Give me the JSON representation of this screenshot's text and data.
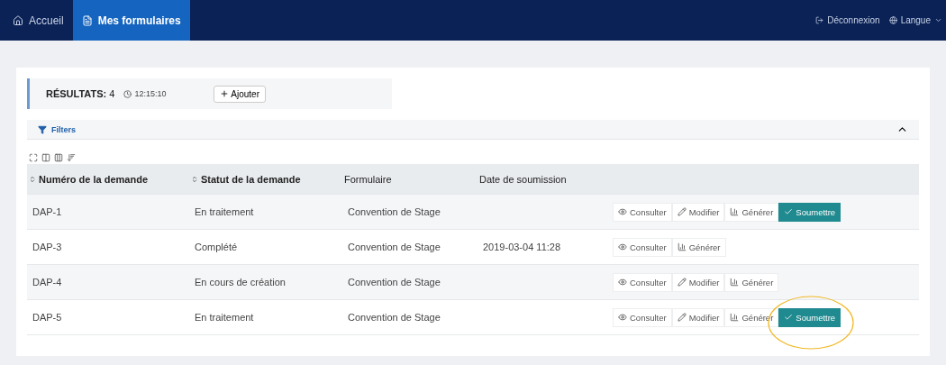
{
  "navbar": {
    "tabs": [
      {
        "kind": "home",
        "label": "Accueil",
        "selected": false
      },
      {
        "kind": "forms",
        "label": "Mes formulaires",
        "selected": true
      }
    ],
    "links": [
      {
        "kind": "logout",
        "label": "Déconnexion"
      },
      {
        "kind": "language",
        "label": "Langue"
      }
    ]
  },
  "results": {
    "label": "RÉSULTATS:",
    "count": "4",
    "time": "12:15:10",
    "add_button": "Ajouter"
  },
  "filters": {
    "label": "Filters",
    "expanded": true
  },
  "table": {
    "columns": [
      {
        "label": "Numéro de la demande",
        "sortable": true
      },
      {
        "label": "Statut de la demande",
        "sortable": true
      },
      {
        "label": "Formulaire",
        "sortable": false
      },
      {
        "label": "Date de soumission",
        "sortable": false
      }
    ],
    "rows": [
      {
        "cells": [
          "DAP-1",
          "En traitement",
          "Convention de Stage",
          ""
        ],
        "circled": false,
        "actions": [
          {
            "kind": "view",
            "label": "Consulter"
          },
          {
            "kind": "edit",
            "label": "Modifier"
          },
          {
            "kind": "generate",
            "label": "Générer"
          },
          {
            "kind": "submit",
            "label": "Soumettre"
          }
        ]
      },
      {
        "cells": [
          "DAP-3",
          "Complété",
          "Convention de Stage",
          "2019-03-04 11:28"
        ],
        "circled": false,
        "actions": [
          {
            "kind": "view",
            "label": "Consulter"
          },
          {
            "kind": "generate",
            "label": "Générer"
          }
        ]
      },
      {
        "cells": [
          "DAP-4",
          "En cours de création",
          "Convention de Stage",
          ""
        ],
        "circled": false,
        "actions": [
          {
            "kind": "view",
            "label": "Consulter"
          },
          {
            "kind": "edit",
            "label": "Modifier"
          },
          {
            "kind": "generate",
            "label": "Générer"
          }
        ]
      },
      {
        "cells": [
          "DAP-5",
          "En traitement",
          "Convention de Stage",
          ""
        ],
        "circled": true,
        "actions": [
          {
            "kind": "view",
            "label": "Consulter"
          },
          {
            "kind": "edit",
            "label": "Modifier"
          },
          {
            "kind": "generate",
            "label": "Générer"
          },
          {
            "kind": "submit",
            "label": "Soumettre"
          }
        ]
      }
    ]
  }
}
